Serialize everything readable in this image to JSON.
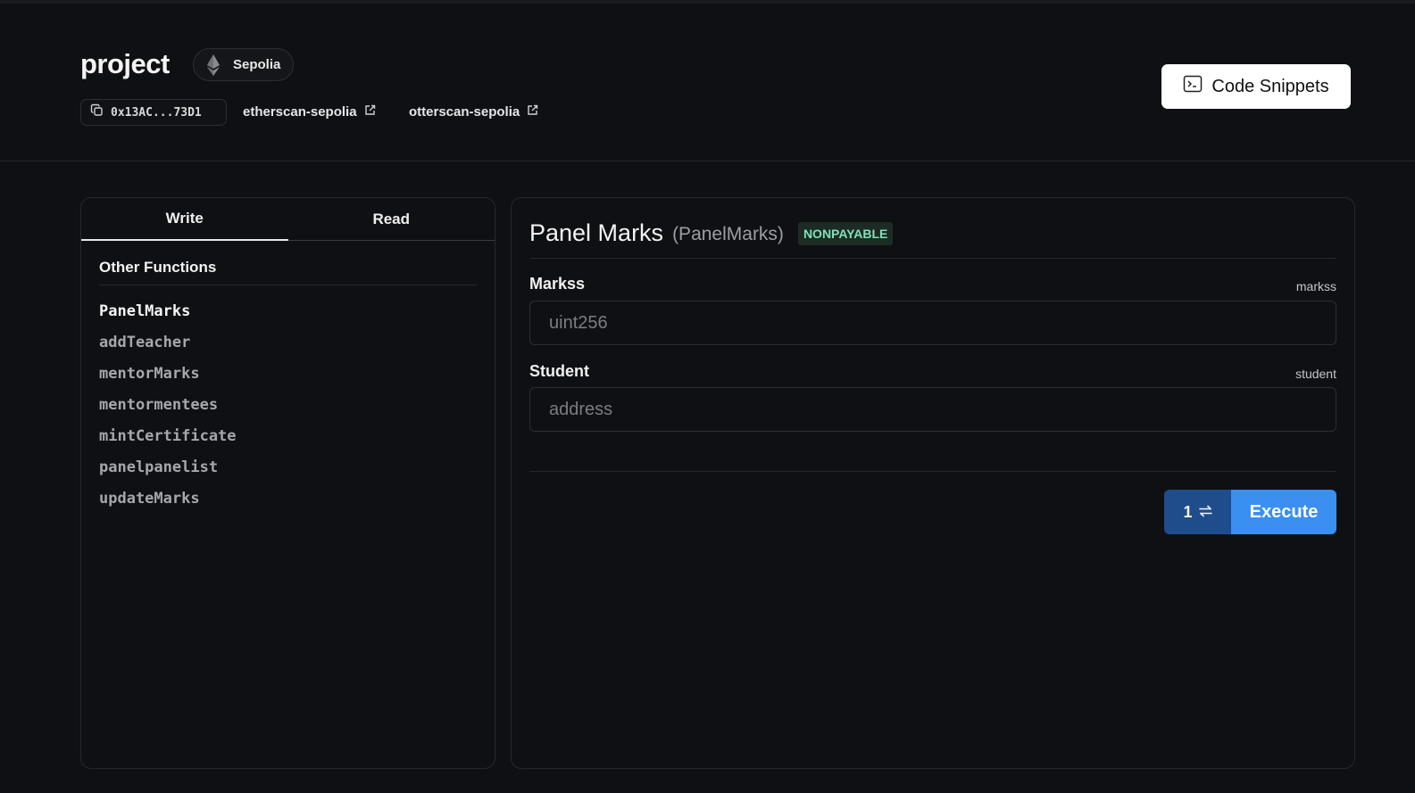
{
  "header": {
    "title": "project",
    "network": "Sepolia",
    "address": "0x13AC...73D1",
    "links": [
      {
        "label": "etherscan-sepolia"
      },
      {
        "label": "otterscan-sepolia"
      }
    ],
    "code_snippets_label": "Code Snippets"
  },
  "sidebar": {
    "tabs": [
      {
        "label": "Write",
        "active": true
      },
      {
        "label": "Read",
        "active": false
      }
    ],
    "section_title": "Other Functions",
    "functions": [
      "PanelMarks",
      "addTeacher",
      "mentorMarks",
      "mentormentees",
      "mintCertificate",
      "panelpanelist",
      "updateMarks"
    ],
    "selected_index": 0
  },
  "function_panel": {
    "title": "Panel Marks",
    "subtitle": "(PanelMarks)",
    "badge": "NONPAYABLE",
    "badge_color": "#7ee2b8",
    "fields": [
      {
        "label": "Markss",
        "key": "markss",
        "placeholder": "uint256",
        "value": ""
      },
      {
        "label": "Student",
        "key": "student",
        "placeholder": "address",
        "value": ""
      }
    ],
    "tx_count": "1",
    "execute_label": "Execute",
    "accent": "#3a8ff0"
  }
}
